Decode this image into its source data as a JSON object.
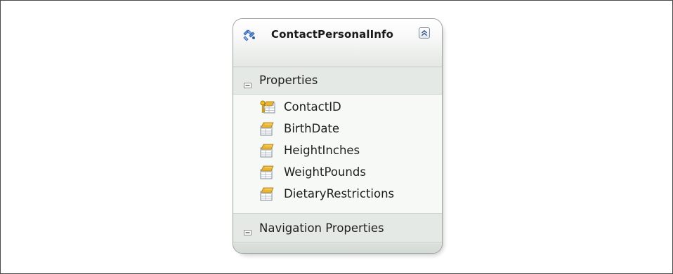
{
  "entity": {
    "title": "ContactPersonalInfo",
    "icon": "entity-type-icon",
    "collapse_icon": "double-chevron-up-icon",
    "sections": {
      "properties": {
        "label": "Properties",
        "toggle_icon": "collapse-minus-icon",
        "items": [
          {
            "label": "ContactID",
            "icon": "key-property-icon"
          },
          {
            "label": "BirthDate",
            "icon": "property-icon"
          },
          {
            "label": "HeightInches",
            "icon": "property-icon"
          },
          {
            "label": "WeightPounds",
            "icon": "property-icon"
          },
          {
            "label": "DietaryRestrictions",
            "icon": "property-icon"
          }
        ]
      },
      "navigation": {
        "label": "Navigation Properties",
        "toggle_icon": "collapse-minus-icon",
        "items": []
      }
    }
  },
  "colors": {
    "header_gradient_top": "#ffffff",
    "header_gradient_bottom": "#e4e7e4",
    "section_header_bg": "#e5e9e5",
    "body_bg": "#f7f9f6",
    "border": "#9aa39c"
  }
}
